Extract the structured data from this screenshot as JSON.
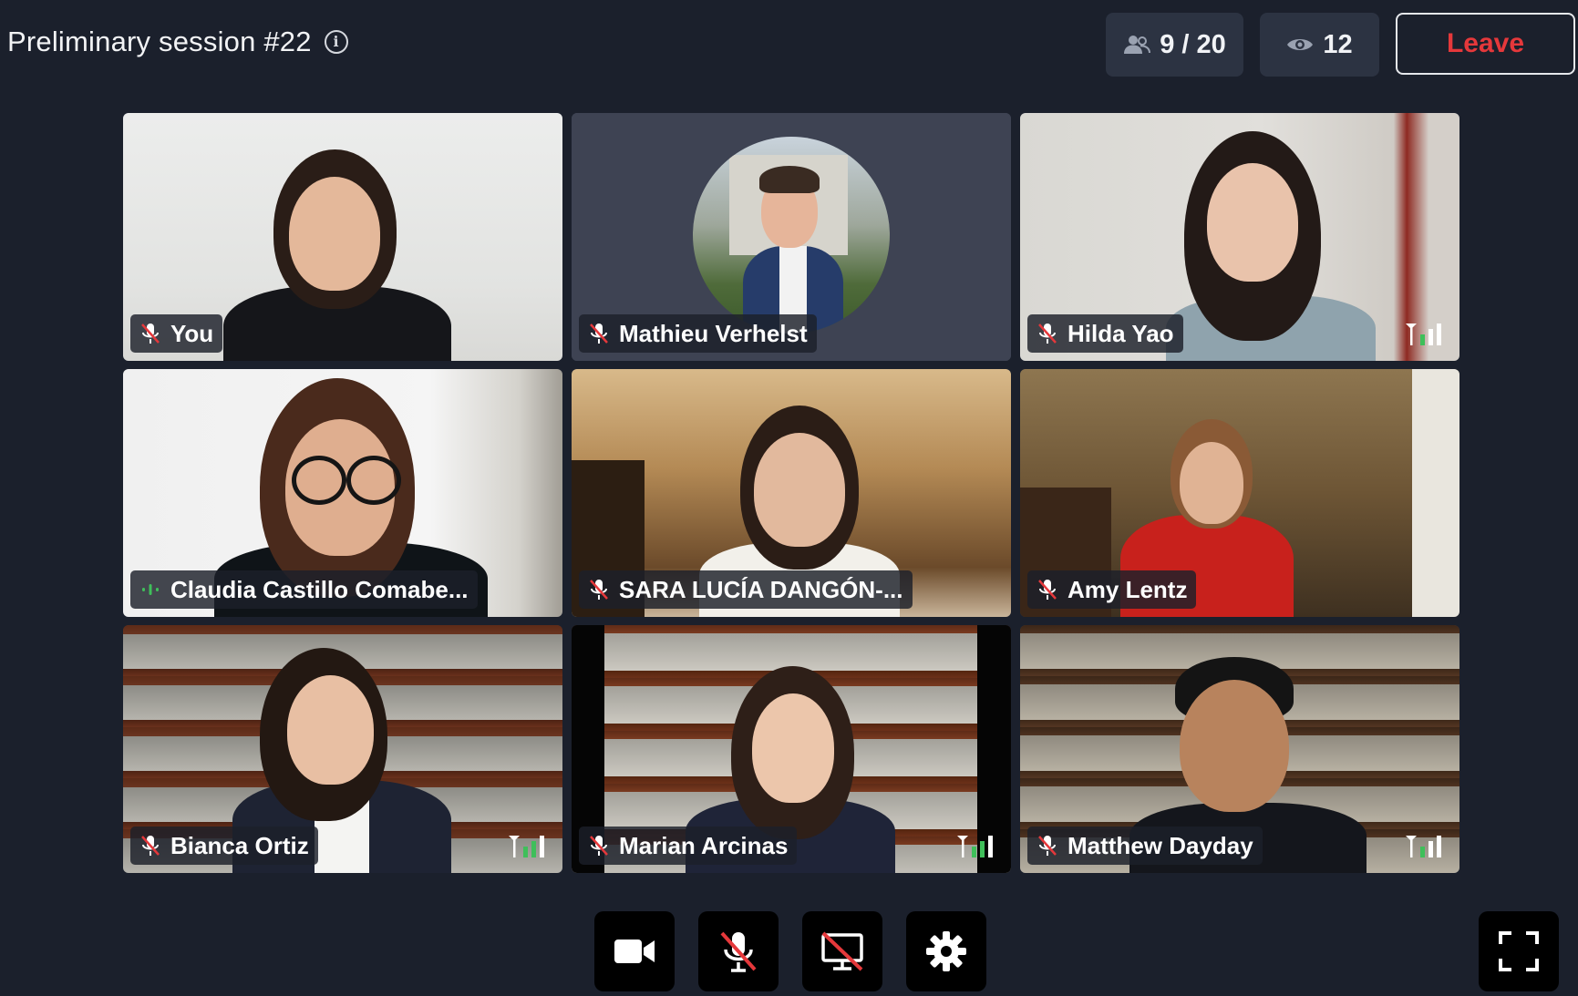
{
  "session": {
    "title": "Preliminary session #22",
    "participants": "9 / 20",
    "viewers": "12",
    "leave_label": "Leave"
  },
  "colors": {
    "background": "#1b202c",
    "pill": "#2c3342",
    "leave_text": "#e5383b",
    "muted_mic": "#e5383b",
    "signal_green": "#3fbf5a"
  },
  "tiles": [
    {
      "name": "You",
      "mic": "muted",
      "signal": ""
    },
    {
      "name": "Mathieu Verhelst",
      "mic": "muted",
      "signal": "",
      "video": "avatar"
    },
    {
      "name": "Hilda Yao",
      "mic": "muted",
      "signal": "weak"
    },
    {
      "name": "Claudia Castillo Comabe...",
      "mic": "speaking",
      "signal": ""
    },
    {
      "name": "SARA LUCÍA DANGÓN-...",
      "mic": "muted",
      "signal": ""
    },
    {
      "name": "Amy Lentz",
      "mic": "muted",
      "signal": ""
    },
    {
      "name": "Bianca Ortiz",
      "mic": "muted",
      "signal": "weak"
    },
    {
      "name": "Marian Arcinas",
      "mic": "muted",
      "signal": "weak"
    },
    {
      "name": "Matthew Dayday",
      "mic": "muted",
      "signal": "weak"
    }
  ],
  "controls": [
    {
      "icon": "camera-icon",
      "state": "on"
    },
    {
      "icon": "mic-off-icon",
      "state": "off"
    },
    {
      "icon": "screen-share-off-icon",
      "state": "off"
    },
    {
      "icon": "gear-icon",
      "state": "on"
    }
  ],
  "fullscreen_icon": "fullscreen-icon"
}
